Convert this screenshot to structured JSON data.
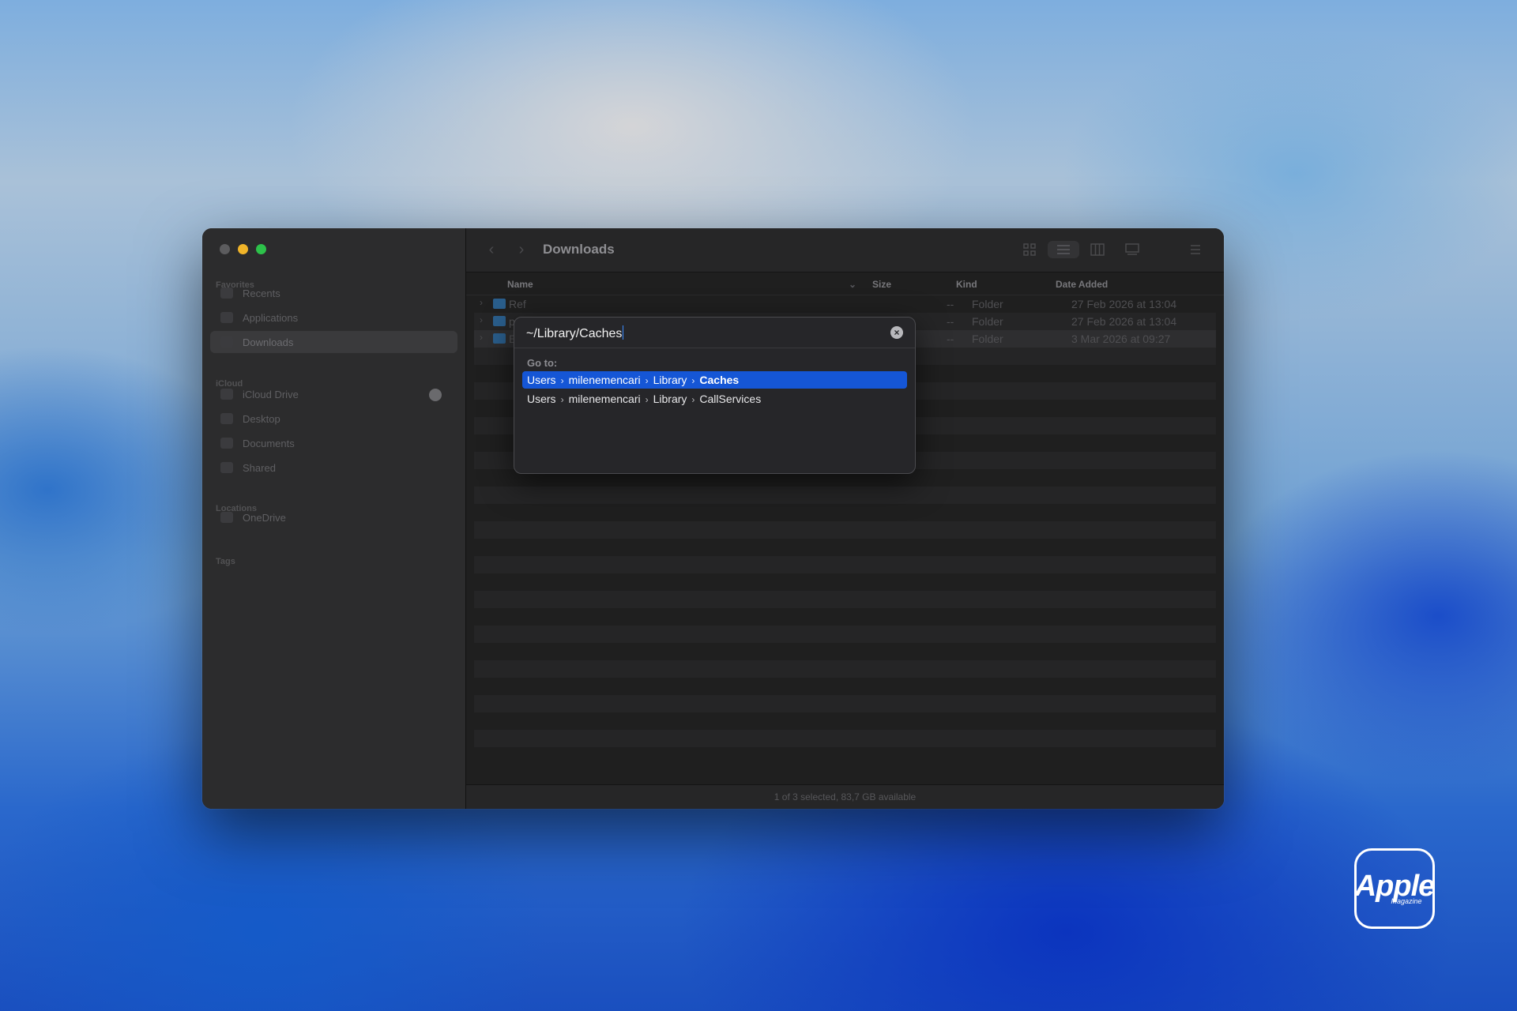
{
  "window": {
    "title": "Downloads"
  },
  "sidebar": {
    "sections": [
      {
        "label": "Favorites",
        "items": [
          "Recents",
          "Applications",
          "Downloads"
        ]
      },
      {
        "label": "iCloud",
        "items": [
          "iCloud Drive",
          "Desktop",
          "Documents",
          "Shared"
        ]
      },
      {
        "label": "Locations",
        "items": [
          "OneDrive"
        ]
      },
      {
        "label": "Tags",
        "items": []
      }
    ],
    "active_item": "Downloads"
  },
  "columns": {
    "name": "Name",
    "size": "Size",
    "kind": "Kind",
    "date_added": "Date Added"
  },
  "rows": [
    {
      "name": "Ref",
      "size": "--",
      "kind": "Folder",
      "date_added": "27 Feb 2026 at 13:04"
    },
    {
      "name": "p",
      "size": "--",
      "kind": "Folder",
      "date_added": "27 Feb 2026 at 13:04"
    },
    {
      "name": "E",
      "size": "--",
      "kind": "Folder",
      "date_added": "3 Mar 2026 at 09:27"
    }
  ],
  "status": "1 of 3 selected, 83,7 GB available",
  "goto": {
    "input_value": "~/Library/Caches",
    "label": "Go to:",
    "suggestions": [
      {
        "parts": [
          "Users",
          "milenemencari",
          "Library"
        ],
        "last": "Caches"
      },
      {
        "parts": [
          "Users",
          "milenemencari",
          "Library"
        ],
        "last": "CallServices"
      }
    ]
  },
  "watermark": {
    "brand": "Apple",
    "sub": "Magazine"
  },
  "colors": {
    "accent": "#1556d6",
    "folder": "#2a5e8c",
    "traffic_min": "#f0b429",
    "traffic_max": "#2dc24a"
  }
}
